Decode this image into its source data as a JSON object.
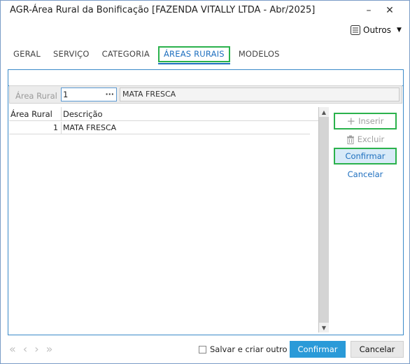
{
  "window": {
    "title": "AGR-Área Rural da Bonificação [FAZENDA VITALLY LTDA - Abr/2025]",
    "minimize_glyph": "–",
    "close_glyph": "✕"
  },
  "toolbar": {
    "outros_label": "Outros",
    "outros_icon": "list-icon"
  },
  "tabs": [
    {
      "label": "GERAL"
    },
    {
      "label": "SERVIÇO"
    },
    {
      "label": "CATEGORIA"
    },
    {
      "label": "ÁREAS RURAIS",
      "active": true
    },
    {
      "label": "MODELOS"
    }
  ],
  "filter": {
    "label": "Área Rural",
    "value": "1",
    "lookup_glyph": "···",
    "description": "MATA FRESCA"
  },
  "grid": {
    "columns": [
      "Área Rural",
      "Descrição"
    ],
    "rows": [
      {
        "area": "1",
        "descricao": "MATA FRESCA"
      }
    ]
  },
  "side_actions": {
    "inserir": "Inserir",
    "excluir": "Excluir",
    "confirmar": "Confirmar",
    "cancelar": "Cancelar"
  },
  "footer": {
    "save_and_create_label": "Salvar e criar outro",
    "confirm_label": "Confirmar",
    "cancel_label": "Cancelar"
  },
  "colors": {
    "accent": "#2a9ad8",
    "highlight_border": "#2bb24c",
    "panel_border": "#3a8ac9"
  }
}
